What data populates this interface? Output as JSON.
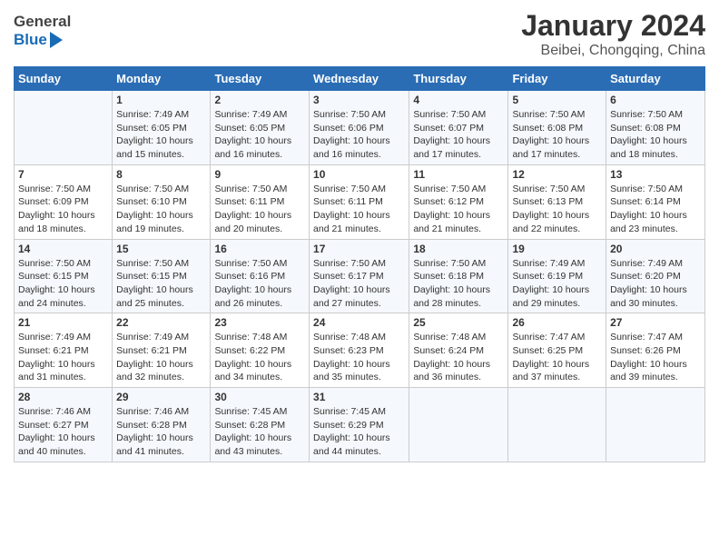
{
  "header": {
    "logo_line1": "General",
    "logo_line2": "Blue",
    "title": "January 2024",
    "subtitle": "Beibei, Chongqing, China"
  },
  "days_of_week": [
    "Sunday",
    "Monday",
    "Tuesday",
    "Wednesday",
    "Thursday",
    "Friday",
    "Saturday"
  ],
  "weeks": [
    [
      {
        "day": "",
        "sunrise": "",
        "sunset": "",
        "daylight": ""
      },
      {
        "day": "1",
        "sunrise": "Sunrise: 7:49 AM",
        "sunset": "Sunset: 6:05 PM",
        "daylight": "Daylight: 10 hours and 15 minutes."
      },
      {
        "day": "2",
        "sunrise": "Sunrise: 7:49 AM",
        "sunset": "Sunset: 6:05 PM",
        "daylight": "Daylight: 10 hours and 16 minutes."
      },
      {
        "day": "3",
        "sunrise": "Sunrise: 7:50 AM",
        "sunset": "Sunset: 6:06 PM",
        "daylight": "Daylight: 10 hours and 16 minutes."
      },
      {
        "day": "4",
        "sunrise": "Sunrise: 7:50 AM",
        "sunset": "Sunset: 6:07 PM",
        "daylight": "Daylight: 10 hours and 17 minutes."
      },
      {
        "day": "5",
        "sunrise": "Sunrise: 7:50 AM",
        "sunset": "Sunset: 6:08 PM",
        "daylight": "Daylight: 10 hours and 17 minutes."
      },
      {
        "day": "6",
        "sunrise": "Sunrise: 7:50 AM",
        "sunset": "Sunset: 6:08 PM",
        "daylight": "Daylight: 10 hours and 18 minutes."
      }
    ],
    [
      {
        "day": "7",
        "sunrise": "Sunrise: 7:50 AM",
        "sunset": "Sunset: 6:09 PM",
        "daylight": "Daylight: 10 hours and 18 minutes."
      },
      {
        "day": "8",
        "sunrise": "Sunrise: 7:50 AM",
        "sunset": "Sunset: 6:10 PM",
        "daylight": "Daylight: 10 hours and 19 minutes."
      },
      {
        "day": "9",
        "sunrise": "Sunrise: 7:50 AM",
        "sunset": "Sunset: 6:11 PM",
        "daylight": "Daylight: 10 hours and 20 minutes."
      },
      {
        "day": "10",
        "sunrise": "Sunrise: 7:50 AM",
        "sunset": "Sunset: 6:11 PM",
        "daylight": "Daylight: 10 hours and 21 minutes."
      },
      {
        "day": "11",
        "sunrise": "Sunrise: 7:50 AM",
        "sunset": "Sunset: 6:12 PM",
        "daylight": "Daylight: 10 hours and 21 minutes."
      },
      {
        "day": "12",
        "sunrise": "Sunrise: 7:50 AM",
        "sunset": "Sunset: 6:13 PM",
        "daylight": "Daylight: 10 hours and 22 minutes."
      },
      {
        "day": "13",
        "sunrise": "Sunrise: 7:50 AM",
        "sunset": "Sunset: 6:14 PM",
        "daylight": "Daylight: 10 hours and 23 minutes."
      }
    ],
    [
      {
        "day": "14",
        "sunrise": "Sunrise: 7:50 AM",
        "sunset": "Sunset: 6:15 PM",
        "daylight": "Daylight: 10 hours and 24 minutes."
      },
      {
        "day": "15",
        "sunrise": "Sunrise: 7:50 AM",
        "sunset": "Sunset: 6:15 PM",
        "daylight": "Daylight: 10 hours and 25 minutes."
      },
      {
        "day": "16",
        "sunrise": "Sunrise: 7:50 AM",
        "sunset": "Sunset: 6:16 PM",
        "daylight": "Daylight: 10 hours and 26 minutes."
      },
      {
        "day": "17",
        "sunrise": "Sunrise: 7:50 AM",
        "sunset": "Sunset: 6:17 PM",
        "daylight": "Daylight: 10 hours and 27 minutes."
      },
      {
        "day": "18",
        "sunrise": "Sunrise: 7:50 AM",
        "sunset": "Sunset: 6:18 PM",
        "daylight": "Daylight: 10 hours and 28 minutes."
      },
      {
        "day": "19",
        "sunrise": "Sunrise: 7:49 AM",
        "sunset": "Sunset: 6:19 PM",
        "daylight": "Daylight: 10 hours and 29 minutes."
      },
      {
        "day": "20",
        "sunrise": "Sunrise: 7:49 AM",
        "sunset": "Sunset: 6:20 PM",
        "daylight": "Daylight: 10 hours and 30 minutes."
      }
    ],
    [
      {
        "day": "21",
        "sunrise": "Sunrise: 7:49 AM",
        "sunset": "Sunset: 6:21 PM",
        "daylight": "Daylight: 10 hours and 31 minutes."
      },
      {
        "day": "22",
        "sunrise": "Sunrise: 7:49 AM",
        "sunset": "Sunset: 6:21 PM",
        "daylight": "Daylight: 10 hours and 32 minutes."
      },
      {
        "day": "23",
        "sunrise": "Sunrise: 7:48 AM",
        "sunset": "Sunset: 6:22 PM",
        "daylight": "Daylight: 10 hours and 34 minutes."
      },
      {
        "day": "24",
        "sunrise": "Sunrise: 7:48 AM",
        "sunset": "Sunset: 6:23 PM",
        "daylight": "Daylight: 10 hours and 35 minutes."
      },
      {
        "day": "25",
        "sunrise": "Sunrise: 7:48 AM",
        "sunset": "Sunset: 6:24 PM",
        "daylight": "Daylight: 10 hours and 36 minutes."
      },
      {
        "day": "26",
        "sunrise": "Sunrise: 7:47 AM",
        "sunset": "Sunset: 6:25 PM",
        "daylight": "Daylight: 10 hours and 37 minutes."
      },
      {
        "day": "27",
        "sunrise": "Sunrise: 7:47 AM",
        "sunset": "Sunset: 6:26 PM",
        "daylight": "Daylight: 10 hours and 39 minutes."
      }
    ],
    [
      {
        "day": "28",
        "sunrise": "Sunrise: 7:46 AM",
        "sunset": "Sunset: 6:27 PM",
        "daylight": "Daylight: 10 hours and 40 minutes."
      },
      {
        "day": "29",
        "sunrise": "Sunrise: 7:46 AM",
        "sunset": "Sunset: 6:28 PM",
        "daylight": "Daylight: 10 hours and 41 minutes."
      },
      {
        "day": "30",
        "sunrise": "Sunrise: 7:45 AM",
        "sunset": "Sunset: 6:28 PM",
        "daylight": "Daylight: 10 hours and 43 minutes."
      },
      {
        "day": "31",
        "sunrise": "Sunrise: 7:45 AM",
        "sunset": "Sunset: 6:29 PM",
        "daylight": "Daylight: 10 hours and 44 minutes."
      },
      {
        "day": "",
        "sunrise": "",
        "sunset": "",
        "daylight": ""
      },
      {
        "day": "",
        "sunrise": "",
        "sunset": "",
        "daylight": ""
      },
      {
        "day": "",
        "sunrise": "",
        "sunset": "",
        "daylight": ""
      }
    ]
  ]
}
